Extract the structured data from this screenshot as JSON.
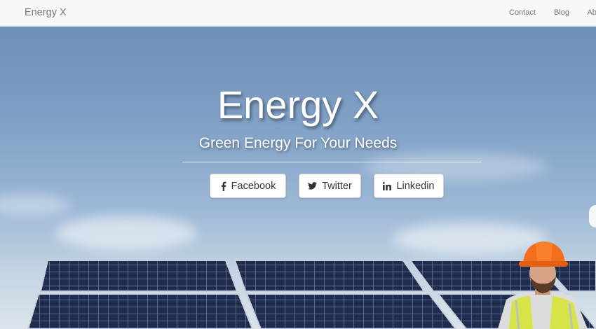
{
  "navbar": {
    "brand": "Energy X",
    "links": [
      {
        "label": "Contact"
      },
      {
        "label": "Blog"
      },
      {
        "label": "About"
      }
    ]
  },
  "hero": {
    "title": "Energy X",
    "subtitle": "Green Energy For Your Needs",
    "buttons": [
      {
        "label": "Facebook",
        "icon": "facebook-icon"
      },
      {
        "label": "Twitter",
        "icon": "twitter-icon"
      },
      {
        "label": "Linkedin",
        "icon": "linkedin-icon"
      }
    ]
  },
  "colors": {
    "navbar_bg": "#f8f8f8",
    "sky": "#7a9cc4",
    "panel": "#1e2a48",
    "helmet": "#f26a1b",
    "vest": "#d9e84a"
  }
}
